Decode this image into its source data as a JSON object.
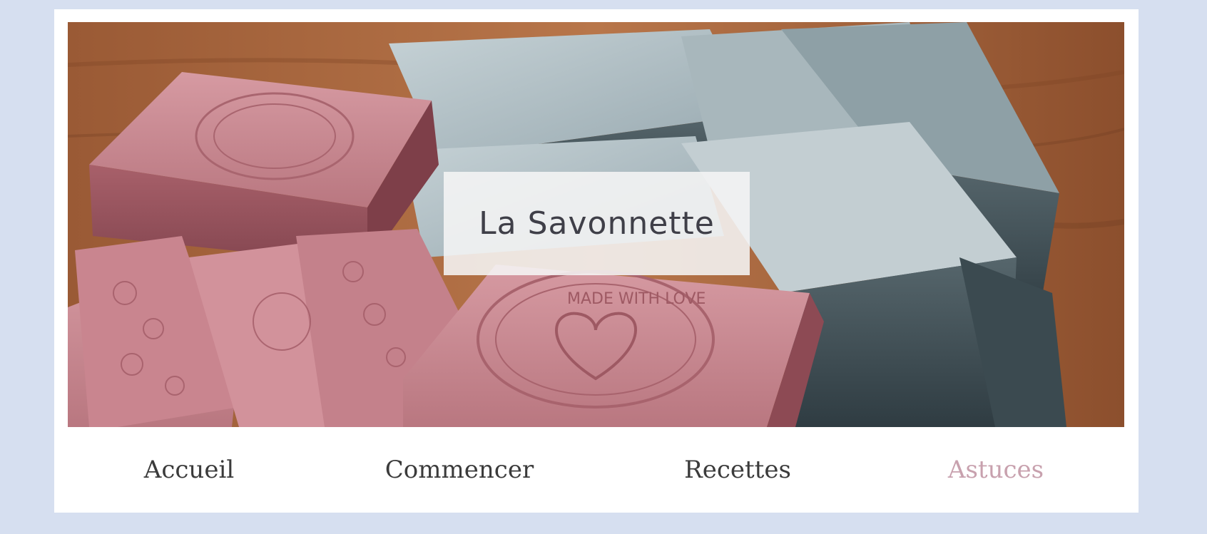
{
  "site": {
    "title": "La Savonnette"
  },
  "hero": {
    "image_icon": "soap-bars-photo",
    "stamp_text": "MADE WITH LOVE"
  },
  "nav": {
    "items": [
      {
        "label": "Accueil",
        "active": false
      },
      {
        "label": "Commencer",
        "active": false
      },
      {
        "label": "Recettes",
        "active": false
      },
      {
        "label": "Astuces",
        "active": true
      }
    ]
  },
  "colors": {
    "page_background": "#d6dff0",
    "card_background": "#ffffff",
    "nav_text": "#3b3b3b",
    "nav_active": "#c8a1ae",
    "title_text": "#3f3f48"
  }
}
